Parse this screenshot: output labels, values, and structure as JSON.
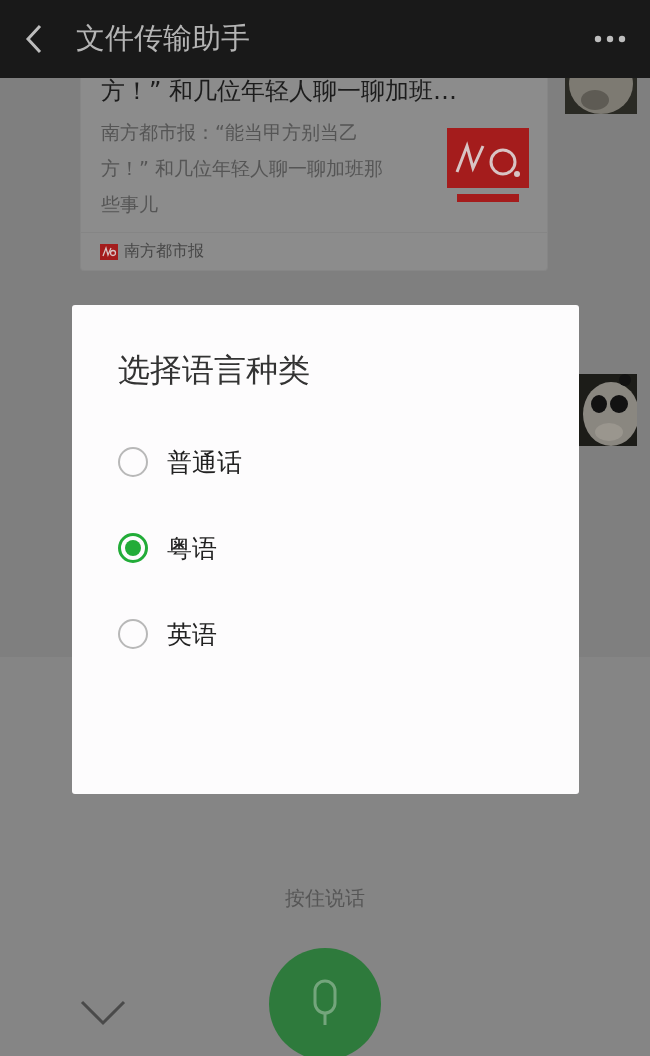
{
  "header": {
    "title": "文件传输助手"
  },
  "article": {
    "title": "方！” 和几位年轻人聊一聊加班…",
    "summary": "南方都市报：“能当甲方别当乙方！” 和几位年轻人聊一聊加班那些事儿",
    "source": "南方都市报"
  },
  "dialog": {
    "title": "选择语言种类",
    "options": [
      {
        "label": "普通话",
        "selected": false
      },
      {
        "label": "粤语",
        "selected": true
      },
      {
        "label": "英语",
        "selected": false
      }
    ]
  },
  "voice_panel": {
    "hint": "按住说话"
  }
}
